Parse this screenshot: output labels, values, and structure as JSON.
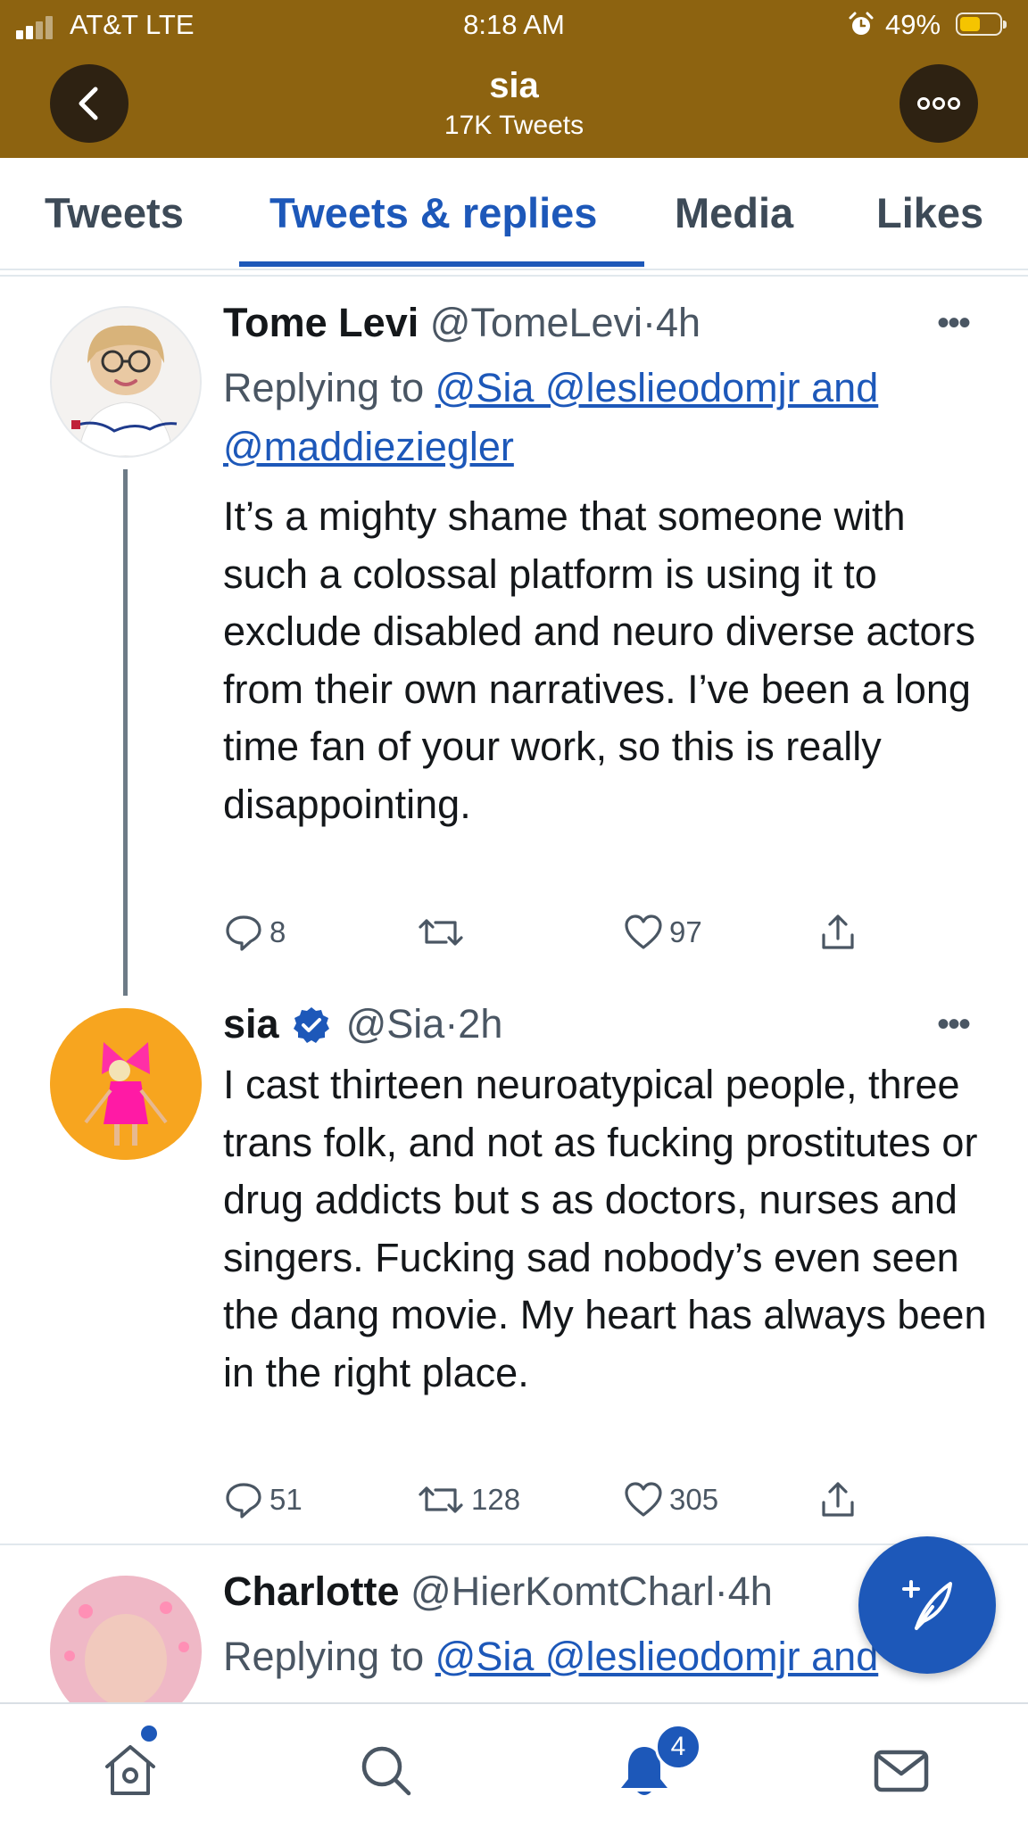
{
  "status_bar": {
    "carrier": "AT&T  LTE",
    "time": "8:18 AM",
    "battery": "49%",
    "battery_level": 0.49
  },
  "header": {
    "name": "sia",
    "tweet_count": "17K Tweets"
  },
  "tabs": [
    {
      "label": "Tweets",
      "active": false
    },
    {
      "label": "Tweets & replies",
      "active": true
    },
    {
      "label": "Media",
      "active": false
    },
    {
      "label": "Likes",
      "active": false
    }
  ],
  "tweets": [
    {
      "name": "Tome Levi",
      "meta": "@TomeLevi·4h",
      "reply_prefix": "Replying to ",
      "mentions": "@Sia @leslieodomjr and @maddieziegler",
      "body": "It’s a mighty shame that someone with such a colossal platform is using it to exclude disabled and neuro diverse actors from their own narratives. I’ve been a long time fan of your work, so this is really disappointing.",
      "replies": "8",
      "retweets": "",
      "likes": "97",
      "avatar_icon": "champion-logo"
    },
    {
      "name": "sia",
      "meta": "@Sia·2h",
      "verified": true,
      "body": "I cast thirteen neuroatypical people, three trans folk, and not as fucking prostitutes or drug addicts but s as doctors, nurses and singers. Fucking sad nobody’s even seen the dang movie. My heart has always been in the right place.",
      "replies": "51",
      "retweets": "128",
      "likes": "305"
    },
    {
      "name": "Charlotte",
      "meta": "@HierKomtCharl·4h",
      "reply_prefix": "Replying to ",
      "mentions": "@Sia @leslieodomjr and"
    }
  ],
  "bottom_nav": {
    "notification_count": "4"
  },
  "colors": {
    "header_bg": "#8d6310",
    "accent": "#1d58b9",
    "verified": "#1d58b9"
  },
  "icons": [
    "back-icon",
    "more-icon",
    "reply-icon",
    "retweet-icon",
    "like-icon",
    "share-icon",
    "compose-icon",
    "home-icon",
    "search-icon",
    "notifications-icon",
    "messages-icon",
    "verified-icon"
  ]
}
